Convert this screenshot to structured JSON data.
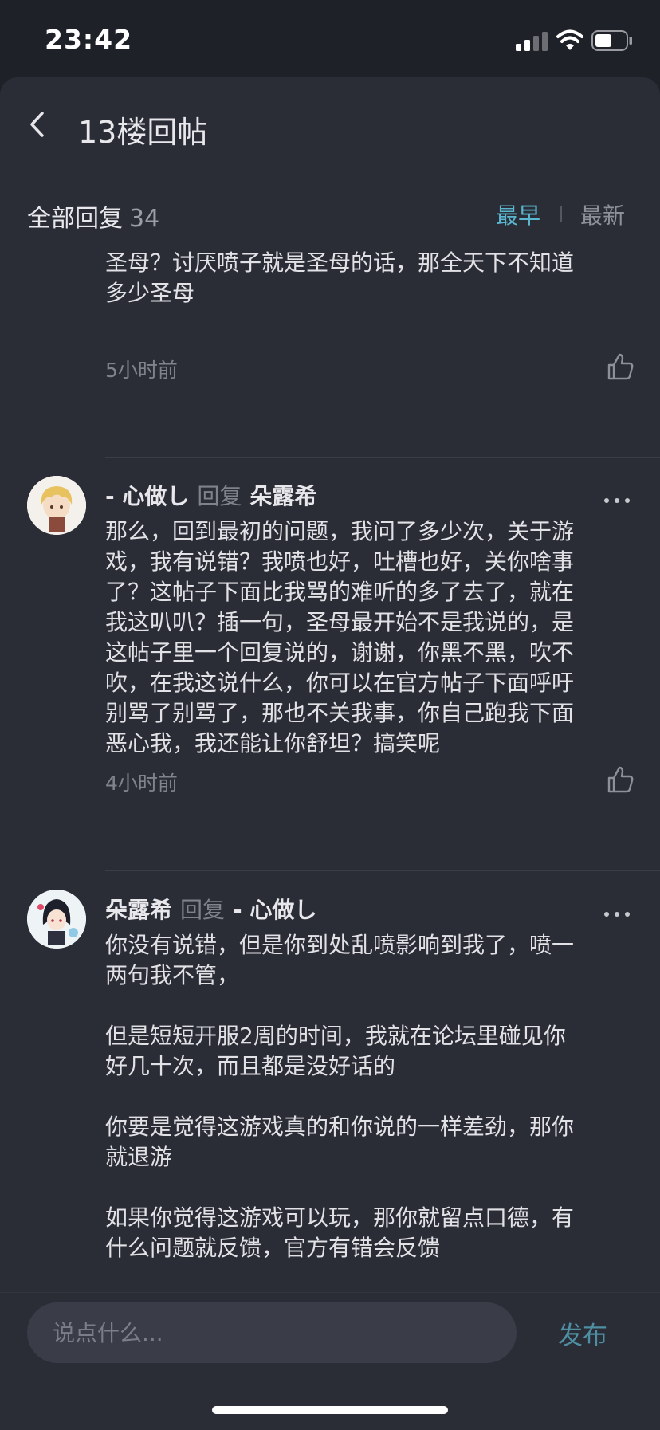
{
  "status_bar": {
    "time": "23:42"
  },
  "header": {
    "title": "13楼回帖"
  },
  "filter": {
    "all_label": "全部回复",
    "count": "34",
    "sort_earliest": "最早",
    "sort_latest": "最新"
  },
  "comments": [
    {
      "text": "圣母？讨厌喷子就是圣母的话，那全天下不知道\n多少圣母",
      "time": "5小时前"
    },
    {
      "author": "-   心做し",
      "reply_word": "回复",
      "reply_to": "朵露希",
      "text": "那么，回到最初的问题，我问了多少次，关于游\n戏，我有说错？我喷也好，吐槽也好，关你啥事\n了？这帖子下面比我骂的难听的多了去了，就在\n我这叭叭？插一句，圣母最开始不是我说的，是\n这帖子里一个回复说的，谢谢，你黑不黑，吹不\n吹，在我这说什么，你可以在官方帖子下面呼吁\n别骂了别骂了，那也不关我事，你自己跑我下面\n恶心我，我还能让你舒坦？搞笑呢",
      "time": "4小时前"
    },
    {
      "author": "朵露希",
      "reply_word": "回复",
      "reply_to": "-   心做し",
      "text": "你没有说错，但是你到处乱喷影响到我了，喷一\n两句我不管，\n\n但是短短开服2周的时间，我就在论坛里碰见你\n好几十次，而且都是没好话的\n\n你要是觉得这游戏真的和你说的一样差劲，那你\n就退游\n\n如果你觉得这游戏可以玩，那你就留点口德，有\n什么问题就反馈，官方有错会反馈"
    }
  ],
  "composer": {
    "placeholder": "说点什么...",
    "publish": "发布"
  },
  "colors": {
    "accent": "#5bb7cf",
    "background": "#2a2c36",
    "status_background": "#1f2129"
  }
}
